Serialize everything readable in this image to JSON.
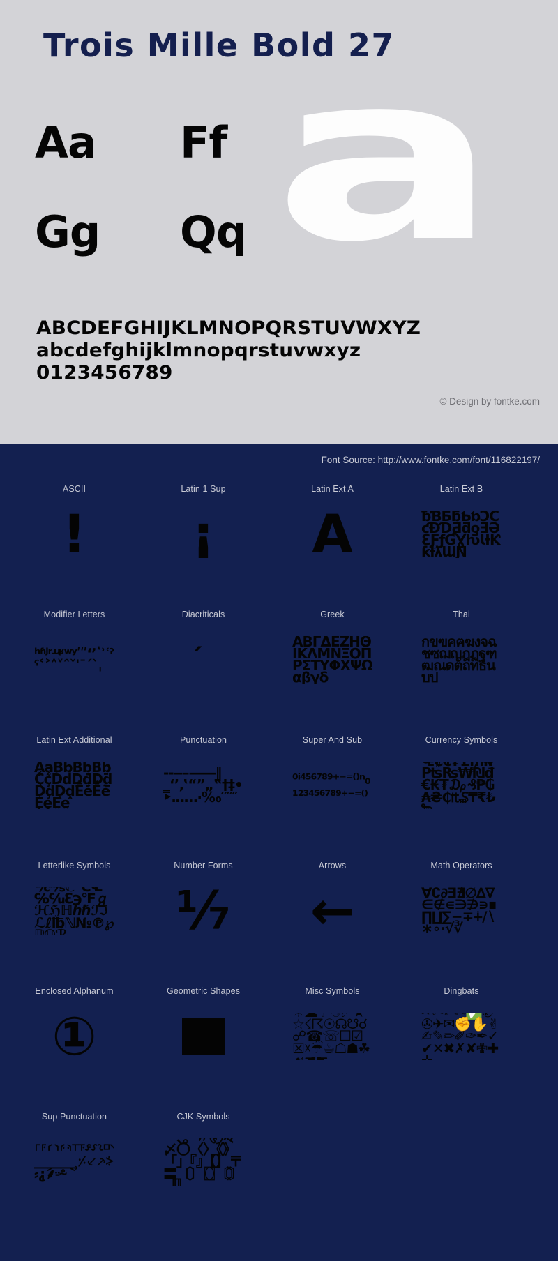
{
  "header": {
    "title": "Trois Mille Bold 27"
  },
  "samples": {
    "pairs": [
      "Aa",
      "Ff",
      "Gg",
      "Qq"
    ],
    "showcase_glyph": "a"
  },
  "charset": {
    "uppercase": "ABCDEFGHIJKLMNOPQRSTUVWXYZ",
    "lowercase": "abcdefghijklmnopqrstuvwxyz",
    "digits": "0123456789"
  },
  "credits": {
    "copyright": "© Design by fontke.com",
    "font_source": "Font Source: http://www.fontke.com/font/116822197/"
  },
  "colors": {
    "panel_light": "#d3d3d7",
    "panel_navy": "#132050",
    "title_navy": "#141f4e",
    "glyph_black": "#040404",
    "glyph_white": "#fdfdfd",
    "label_gray": "#c7c9d4"
  },
  "unicode_blocks": [
    {
      "label": "ASCII",
      "glyph": "!",
      "style": "sw-big"
    },
    {
      "label": "Latin 1 Sup",
      "glyph": "¡",
      "style": "sw-big"
    },
    {
      "label": "Latin Ext A",
      "glyph": "Ā",
      "style": "sw-big"
    },
    {
      "label": "Latin Ext B",
      "glyph": "ƀƁƂƃƄƅƆƇƈƉƊƋƌƍƎƏƐƑƒƓƔƕƖƗƘƙƚƛƜƝ",
      "style": "sw-dense"
    },
    {
      "label": "Modifier Letters",
      "glyph": "ʰʱʲʳʴʵʶʷʸʹʺʻʼʽʾʿˀˁ˂˃˄˅ˆˇˈˉˊˋˌ",
      "style": "sw-dense"
    },
    {
      "label": "Diacriticals",
      "glyph": "́",
      "style": "sw-small"
    },
    {
      "label": "Greek",
      "glyph": "ΑΒΓΔΕΖΗΘΙΚΛΜΝΞΟΠΡΣΤΥΦΧΨΩαβγδ",
      "style": "sw-dense"
    },
    {
      "label": "Thai",
      "glyph": "กขฃคฅฆงจฉชซฌญฎฏฐฑฒณดตถทธนบป",
      "style": "sw-dense"
    },
    {
      "label": "Latin Ext Additional",
      "glyph": "ḀḁḂḃḄḅḆḇḈḉḊḋḌḍḎḏḐḑḒḓḔḕḖḗḘḙḚḛ",
      "style": "sw-dense"
    },
    {
      "label": "Punctuation",
      "glyph": "‐‑‒–—―‖‗‘’‚‛“”„‟†‡•‣․‥…‧‰′″‴",
      "style": "sw-dense"
    },
    {
      "label": "Super And Sub",
      "glyph": "⁰ⁱ⁴⁵⁶⁷⁸⁹⁺⁻⁼⁽⁾ⁿ₀₁₂₃₄₅₆₇₈₉₊₋₌₍₎",
      "style": "sw-dense"
    },
    {
      "label": "Currency Symbols",
      "glyph": "₠₡₢₣₤₥₦₧₨₩₪₫€₭₮₯₰₱₲₳₴₵₶₷₸₹₺₻",
      "style": "sw-dense"
    },
    {
      "label": "Letterlike Symbols",
      "glyph": "℀℁ℂ℃℄℅℆ℇ℈℉ℊℋℌℍℎℏℐℑℒℓ℔ℕ№℗℘ℙℚℛ",
      "style": "sw-dense"
    },
    {
      "label": "Number Forms",
      "glyph": "⅐",
      "style": "sw-big"
    },
    {
      "label": "Arrows",
      "glyph": "←",
      "style": "sw-big"
    },
    {
      "label": "Math Operators",
      "glyph": "∀∁∂∃∄∅∆∇∈∉∊∋∌∍∎∏∐∑−∓∔∕∖∗∘∙√∛",
      "style": "sw-dense"
    },
    {
      "label": "Enclosed Alphanum",
      "glyph": "①",
      "style": "sw-big"
    },
    {
      "label": "Geometric Shapes",
      "glyph": "■",
      "style": "sw-box"
    },
    {
      "label": "Misc Symbols",
      "glyph": "☀☁☂☃☄★☆☇☈☉☊☋☌☍☎☏☐☑☒☓☔☕☖☗☘☙☚☛",
      "style": "sw-dense"
    },
    {
      "label": "Dingbats",
      "glyph": "✁✂✃✄✅✆✇✈✉✊✋✌✍✎✏✐✑✒✓✔✕✖✗✘✙✚✛",
      "style": "sw-dense"
    },
    {
      "label": "Sup Punctuation",
      "glyph": "⸀⸁⸂⸃⸄⸅⸆⸇⸈⸉⸊⸋⸌⸍⸎⸏⸐⸑⸒⸓⸔⸕⸖⸗⸘⸙⸚⸛",
      "style": "sw-dense"
    },
    {
      "label": "CJK Symbols",
      "glyph": "　、。〃〄々〆〇〈〉《》「」『』【】〒〓〔〕〖〗〘〙〚〛",
      "style": "sw-dense"
    }
  ]
}
